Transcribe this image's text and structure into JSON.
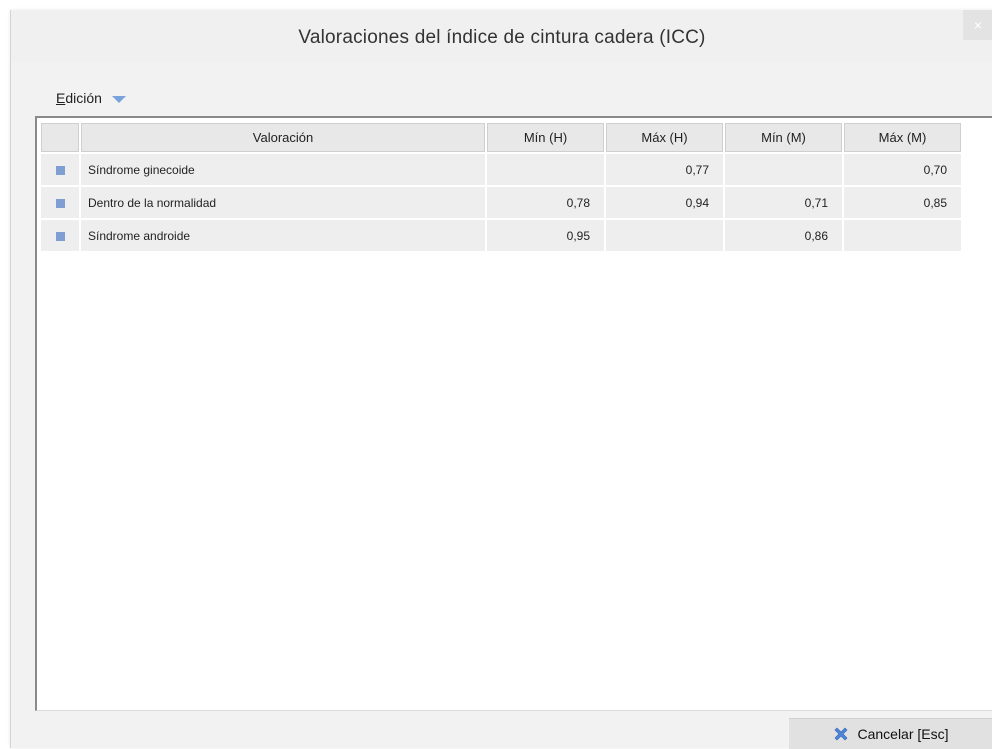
{
  "window": {
    "title": "Valoraciones del índice de cintura cadera (ICC)",
    "close_label": "×"
  },
  "menu": {
    "edicion_first": "E",
    "edicion_rest": "dición"
  },
  "table": {
    "columns": [
      "",
      "Valoración",
      "Mín (H)",
      "Máx (H)",
      "Mín (M)",
      "Máx (M)"
    ],
    "rows": [
      {
        "label": "Síndrome ginecoide",
        "min_h": "",
        "max_h": "0,77",
        "min_m": "",
        "max_m": "0,70"
      },
      {
        "label": "Dentro de la normalidad",
        "min_h": "0,78",
        "max_h": "0,94",
        "min_m": "0,71",
        "max_m": "0,85"
      },
      {
        "label": "Síndrome androide",
        "min_h": "0,95",
        "max_h": "",
        "min_m": "0,86",
        "max_m": ""
      }
    ]
  },
  "footer": {
    "cancel_label": "Cancelar [Esc]"
  },
  "colors": {
    "row_marker": "#7f9fd3",
    "menu_caret": "#7aa2dc",
    "cancel_icon": "#4f86d9"
  }
}
